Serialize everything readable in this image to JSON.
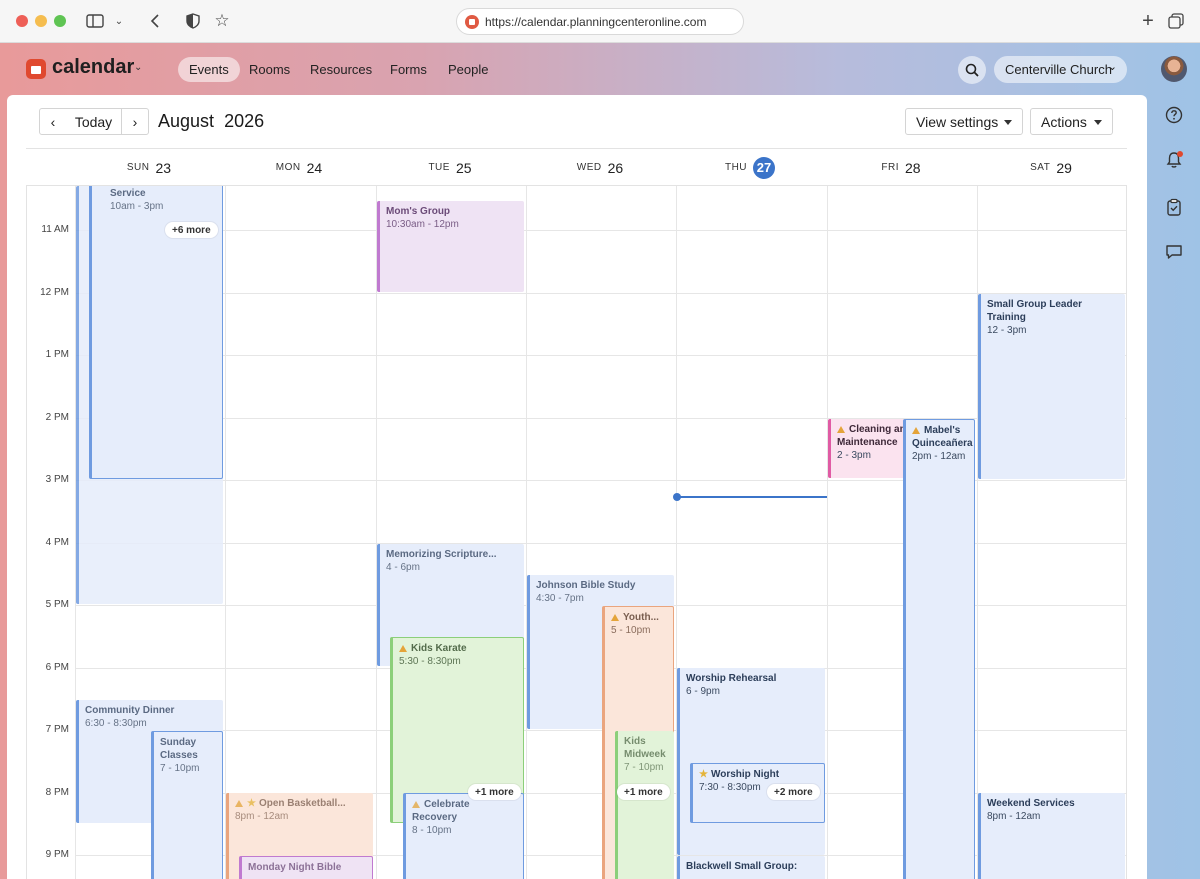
{
  "browser": {
    "url": "https://calendar.planningcenteronline.com"
  },
  "app": {
    "name": "calendar",
    "nav": [
      "Events",
      "Rooms",
      "Resources",
      "Forms",
      "People"
    ],
    "active_nav": "Events",
    "org": "Centerville Church"
  },
  "toolbar": {
    "today": "Today",
    "prev": "‹",
    "next": "›",
    "month": "August",
    "year": "2026",
    "view_settings": "View settings",
    "actions": "Actions"
  },
  "days": [
    {
      "name": "SUN",
      "num": "23"
    },
    {
      "name": "MON",
      "num": "24"
    },
    {
      "name": "TUE",
      "num": "25"
    },
    {
      "name": "WED",
      "num": "26"
    },
    {
      "name": "THU",
      "num": "27",
      "today": true
    },
    {
      "name": "FRI",
      "num": "28"
    },
    {
      "name": "SAT",
      "num": "29"
    }
  ],
  "hours": [
    "11 AM",
    "12 PM",
    "1 PM",
    "2 PM",
    "3 PM",
    "4 PM",
    "5 PM",
    "6 PM",
    "7 PM",
    "8 PM",
    "9 PM"
  ],
  "events": {
    "sun_service": {
      "title": "Service",
      "time": "10am - 3pm"
    },
    "sun_more": "+6 more",
    "moms_group": {
      "title": "Mom's Group",
      "time": "10:30am - 12pm"
    },
    "small_group_leader": {
      "title": "Small Group Leader Training",
      "time": "12 - 3pm"
    },
    "cleaning": {
      "title": "Cleaning and Maintenance",
      "time": "2 - 3pm"
    },
    "mabels": {
      "title": "Mabel's Quinceañera",
      "time": "2pm - 12am"
    },
    "memorizing": {
      "title": "Memorizing Scripture...",
      "time": "4 - 6pm"
    },
    "johnson": {
      "title": "Johnson Bible Study",
      "time": "4:30 - 7pm"
    },
    "youth": {
      "title": "Youth...",
      "time": "5 - 10pm"
    },
    "kids_karate": {
      "title": "Kids Karate",
      "time": "5:30 - 8:30pm"
    },
    "worship_rehearsal": {
      "title": "Worship Rehearsal",
      "time": "6 - 9pm"
    },
    "community_dinner": {
      "title": "Community Dinner",
      "time": "6:30 - 8:30pm"
    },
    "sunday_classes": {
      "title": "Sunday Classes",
      "time": "7 - 10pm"
    },
    "kids_midweek": {
      "title": "Kids Midweek",
      "time": "7 - 10pm"
    },
    "worship_night": {
      "title": "Worship Night",
      "time": "7:30 - 8:30pm"
    },
    "worship_night_more": "+2 more",
    "open_basketball": {
      "title": "Open Basketball...",
      "time": "8pm - 12am"
    },
    "celebrate_recovery": {
      "title": "Celebrate Recovery",
      "time": "8 - 10pm"
    },
    "tue_more": "+1 more",
    "wed_more": "+1 more",
    "weekend_services": {
      "title": "Weekend Services",
      "time": "8pm - 12am"
    },
    "monday_night_bible": {
      "title": "Monday Night Bible"
    },
    "blackwell": {
      "title": "Blackwell Small Group:"
    }
  },
  "colors": {
    "brand": "#e0492f",
    "today": "#3b74c9",
    "now_line": "#3b74c9"
  }
}
